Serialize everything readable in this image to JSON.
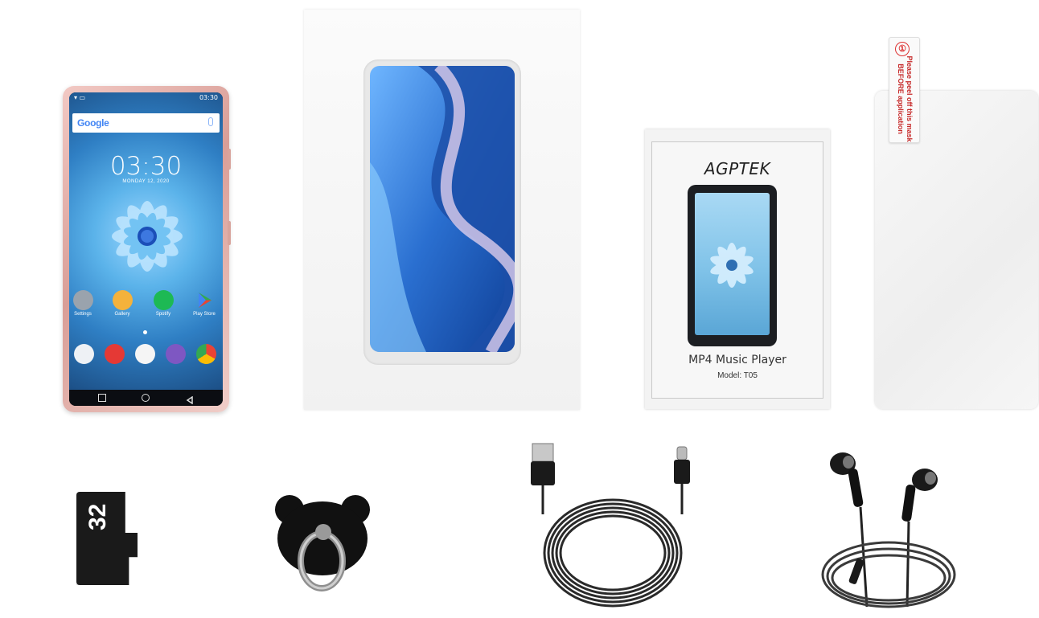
{
  "phone": {
    "status_time": "03:30",
    "search_brand": "Google",
    "clock_time": "03:30",
    "clock_date": "MONDAY 12, 2020",
    "apps": [
      {
        "label": "Settings",
        "icon": "gear-icon",
        "color": "#9aa3ad"
      },
      {
        "label": "Gallery",
        "icon": "gallery-icon",
        "color": "#f4b23b"
      },
      {
        "label": "Spotify",
        "icon": "spotify-icon",
        "color": "#1db954"
      },
      {
        "label": "Play Store",
        "icon": "play-store-icon",
        "color": "#ffffff"
      }
    ],
    "dock": [
      {
        "icon": "book-icon",
        "color": "#eef1f5"
      },
      {
        "icon": "video-icon",
        "color": "#e53935"
      },
      {
        "icon": "app-drawer-icon",
        "color": "#f5f5f5"
      },
      {
        "icon": "music-icon",
        "color": "#7e57c2"
      },
      {
        "icon": "chrome-icon",
        "color": "#fbbc05"
      }
    ]
  },
  "manual": {
    "brand": "AGPTEK",
    "product_name": "MP4 Music Player",
    "model": "Model: T05"
  },
  "protector_tab": {
    "number": "①",
    "text": "Please peel off this mask BEFORE application"
  },
  "sd_card": {
    "capacity": "32"
  },
  "accent_colors": {
    "phone_body": "#e5b2ab",
    "box_art_blue": "#2a6fd0",
    "tab_red": "#c62828"
  }
}
